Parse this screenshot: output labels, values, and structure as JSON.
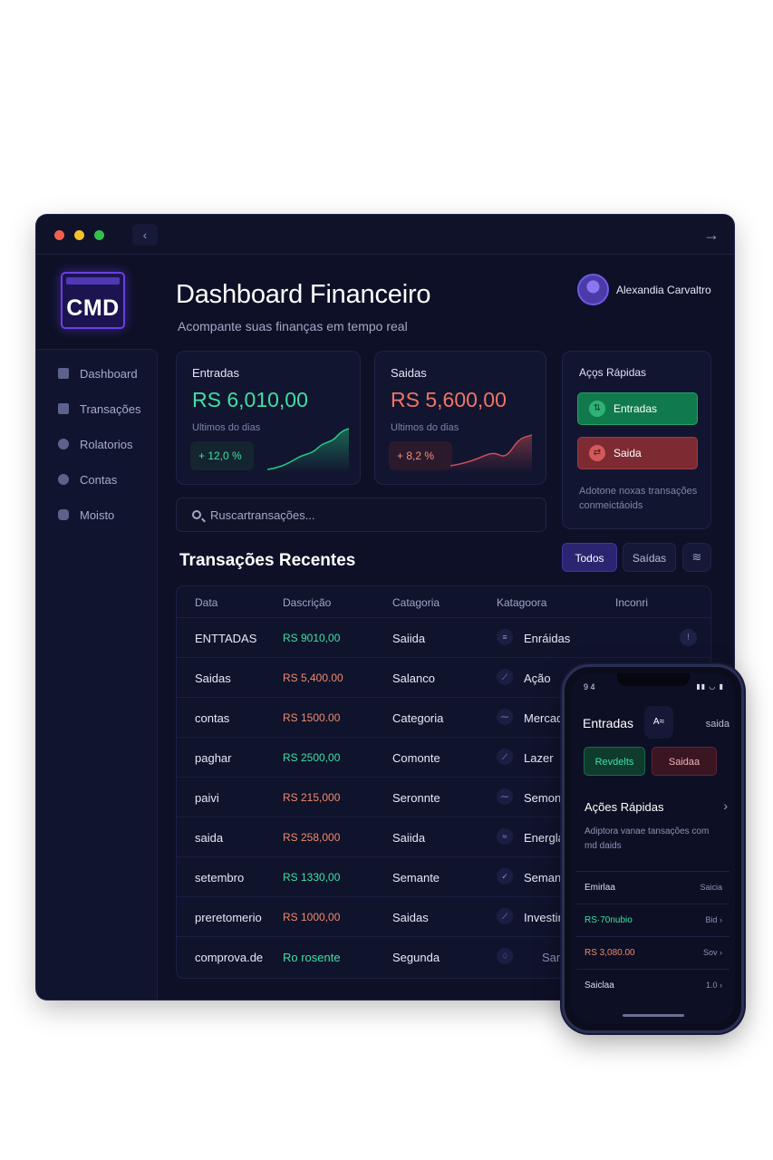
{
  "window": {
    "back_icon": "‹",
    "forward_icon": "→"
  },
  "logo": {
    "text": "CMD"
  },
  "header": {
    "title": "Dashboard Financeiro",
    "subtitle": "Acompante suas finanças em tempo real"
  },
  "user": {
    "name": "Alexandia Carvaltro"
  },
  "sidebar": {
    "items": [
      {
        "label": "Dashboard",
        "icon": "home-icon"
      },
      {
        "label": "Transações",
        "icon": "clipboard-icon"
      },
      {
        "label": "Rolatorios",
        "icon": "report-icon"
      },
      {
        "label": "Contas",
        "icon": "wallet-icon"
      },
      {
        "label": "Moisto",
        "icon": "settings-icon"
      }
    ]
  },
  "cards": {
    "income": {
      "label": "Entradas",
      "value": "RS 6,010,00",
      "note": "Ultimos do dias",
      "delta": "+ 12,0 %"
    },
    "expense": {
      "label": "Saidas",
      "value": "RS 5,600,00",
      "note": "Ultimos do dias",
      "delta": "+ 8,2 %"
    }
  },
  "quick_actions": {
    "title": "Açǫs Rápidas",
    "income_btn": "Entradas",
    "expense_btn": "Saida",
    "footer": "Adotone noxas transações conmeictáoids"
  },
  "search": {
    "placeholder": "Ruscartransações..."
  },
  "transactions": {
    "title": "Transações Recentes",
    "filter_all": "Todos",
    "filter_out": "Saídas",
    "filter_icon": "≋",
    "columns": [
      "Data",
      "Dascrição",
      "Catagoria",
      "Katagoora",
      "Inconri"
    ],
    "rows": [
      {
        "data": "ENTTADAS",
        "amount": "RS 9010,00",
        "type": "in",
        "category": "Saiida",
        "icon": "≡",
        "tag": "Enráidas",
        "action": "!"
      },
      {
        "data": "Saidas",
        "amount": "RS 5,400.00",
        "type": "out",
        "category": "Salanco",
        "icon": "⟋",
        "tag": "Ação",
        "action": ""
      },
      {
        "data": "contas",
        "amount": "RS  1500.00",
        "type": "out",
        "category": "Categoria",
        "icon": "⁓",
        "tag": "Mercada",
        "action": ""
      },
      {
        "data": "paghar",
        "amount": "RS 2500,00",
        "type": "in",
        "category": "Comonte",
        "icon": "⟋",
        "tag": "Lazer",
        "action": ""
      },
      {
        "data": "paivi",
        "amount": "RS 215,000",
        "type": "out",
        "category": "Seronnte",
        "icon": "⁓",
        "tag": "Semonia",
        "action": ""
      },
      {
        "data": "saida",
        "amount": "RS 258,000",
        "type": "out",
        "category": "Saiida",
        "icon": "≈",
        "tag": "Energla",
        "action": ""
      },
      {
        "data": "setembro",
        "amount": "RS 1330,00",
        "type": "in",
        "category": "Semante",
        "icon": "✓",
        "tag": "Semans",
        "action": ""
      },
      {
        "data": "preretomerio",
        "amount": "RS  1000,00",
        "type": "out",
        "category": "Saidas",
        "icon": "⟋",
        "tag": "Investin",
        "action": ""
      },
      {
        "data": "comprova.de",
        "amount": "Ro rosente",
        "type": "in",
        "category": "Segunda",
        "icon": "♢",
        "tag": "San",
        "action": ""
      }
    ]
  },
  "phone": {
    "time": "9 4",
    "status": "▮▮ ◡ ▮",
    "title": "Entradas",
    "chip": "A≈",
    "saida_label": "saida",
    "btn_income": "Revdelts",
    "btn_expense": "Saidaa",
    "section": "Ações Rápidas",
    "chevron": "›",
    "desc": "Adiptora vanae tansações com md daids",
    "rows": [
      {
        "left": "Emirlaa",
        "right": "Saicia",
        "type": "plain"
      },
      {
        "left": "RS·70nubio",
        "right": "Bid ›",
        "type": "in"
      },
      {
        "left": "RS 3,080.00",
        "right": "Sov ›",
        "type": "out"
      },
      {
        "left": "Saiclaa",
        "right": "1.0 ›",
        "type": "plain"
      }
    ]
  },
  "colors": {
    "income": "#3ee0a3",
    "expense": "#f07566",
    "accent": "#6a3fe0",
    "background": "#0e1027"
  }
}
